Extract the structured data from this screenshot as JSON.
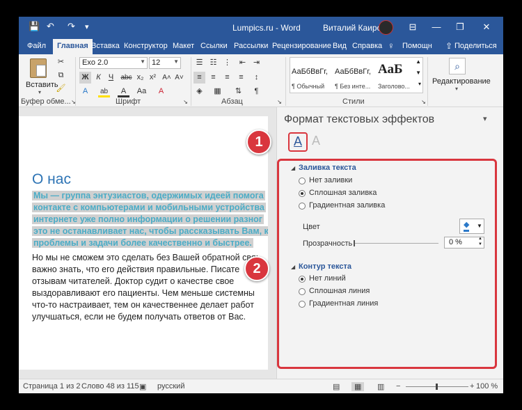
{
  "window": {
    "title": "Lumpics.ru - Word",
    "user": "Виталий Каиров",
    "quick_access": {
      "save": "💾",
      "undo": "↶",
      "redo": "↷",
      "customize": "▾"
    },
    "controls": {
      "ribbon_display": "⊟",
      "minimize": "—",
      "restore": "❐",
      "close": "✕"
    }
  },
  "tabs": [
    {
      "label": "Файл"
    },
    {
      "label": "Главная"
    },
    {
      "label": "Вставка"
    },
    {
      "label": "Конструктор"
    },
    {
      "label": "Макет"
    },
    {
      "label": "Ссылки"
    },
    {
      "label": "Рассылки"
    },
    {
      "label": "Рецензирование"
    },
    {
      "label": "Вид"
    },
    {
      "label": "Справка"
    },
    {
      "label": "Помощн"
    },
    {
      "label": "Поделиться"
    }
  ],
  "ribbon": {
    "clipboard": {
      "paste": "Вставить",
      "label": "Буфер обме..."
    },
    "font": {
      "name": "Exo 2.0",
      "size": "12",
      "label": "Шрифт",
      "buttons": {
        "bold": "Ж",
        "italic": "К",
        "underline": "Ч",
        "strike": "abc",
        "sub": "x₂",
        "sup": "x²",
        "grow": "A˄",
        "shrink": "A˅",
        "case": "Aa",
        "clear": "A",
        "effects": "A",
        "highlight": "ab",
        "color": "A"
      }
    },
    "paragraph": {
      "label": "Абзац",
      "marks": "¶"
    },
    "styles": {
      "label": "Стили",
      "items": [
        {
          "preview": "АаБбВвГг,",
          "name": "¶ Обычный"
        },
        {
          "preview": "АаБбВвГг,",
          "name": "¶ Без инте..."
        },
        {
          "preview": "АаБ",
          "name": "Заголово..."
        }
      ]
    },
    "editing": {
      "label": "Редактирование"
    }
  },
  "document": {
    "heading": "О нас",
    "highlighted_lines": [
      "Мы — группа энтузиастов, одержимых идеей помога",
      "контакте с компьютерами и мобильными устройства",
      "интернете уже полно информации о решении разног",
      "это не останавливает нас, чтобы рассказывать Вам, к",
      "проблемы и задачи более качественно и быстрее."
    ],
    "body_lines": [
      "Но мы не сможем это сделать без Вашей обратной свя:",
      "важно знать, что его действия правильные. Писате",
      "отзывам читателей. Доктор судит о качестве свое",
      "выздоравливают его пациенты. Чем меньше системны",
      "что-то настраивает, тем он качественнее делает работ",
      "улучшаться, если не будем получать ответов от Вас."
    ]
  },
  "pane": {
    "title": "Формат текстовых эффектов",
    "tab_fill_icon": "A",
    "tab_effects_icon": "A",
    "fill": {
      "title": "Заливка текста",
      "options": [
        "Нет заливки",
        "Сплошная заливка",
        "Градиентная заливка"
      ],
      "selected": 1,
      "color_label": "Цвет",
      "transparency_label": "Прозрачность",
      "transparency_value": "0 %"
    },
    "outline": {
      "title": "Контур текста",
      "options": [
        "Нет линий",
        "Сплошная линия",
        "Градиентная линия"
      ],
      "selected": 0
    },
    "collapse": "▾",
    "close": "✕"
  },
  "badges": [
    "1",
    "2"
  ],
  "status": {
    "page": "Страница 1 из 2",
    "words": "Слово 48 из 115",
    "language": "русский",
    "zoom": "100 %",
    "zoom_out": "−",
    "zoom_in": "+"
  },
  "colors": {
    "accent": "#2b579a",
    "highlight_text": "#4bacc6",
    "annotation": "#d9363e",
    "heading": "#2e74b5"
  }
}
